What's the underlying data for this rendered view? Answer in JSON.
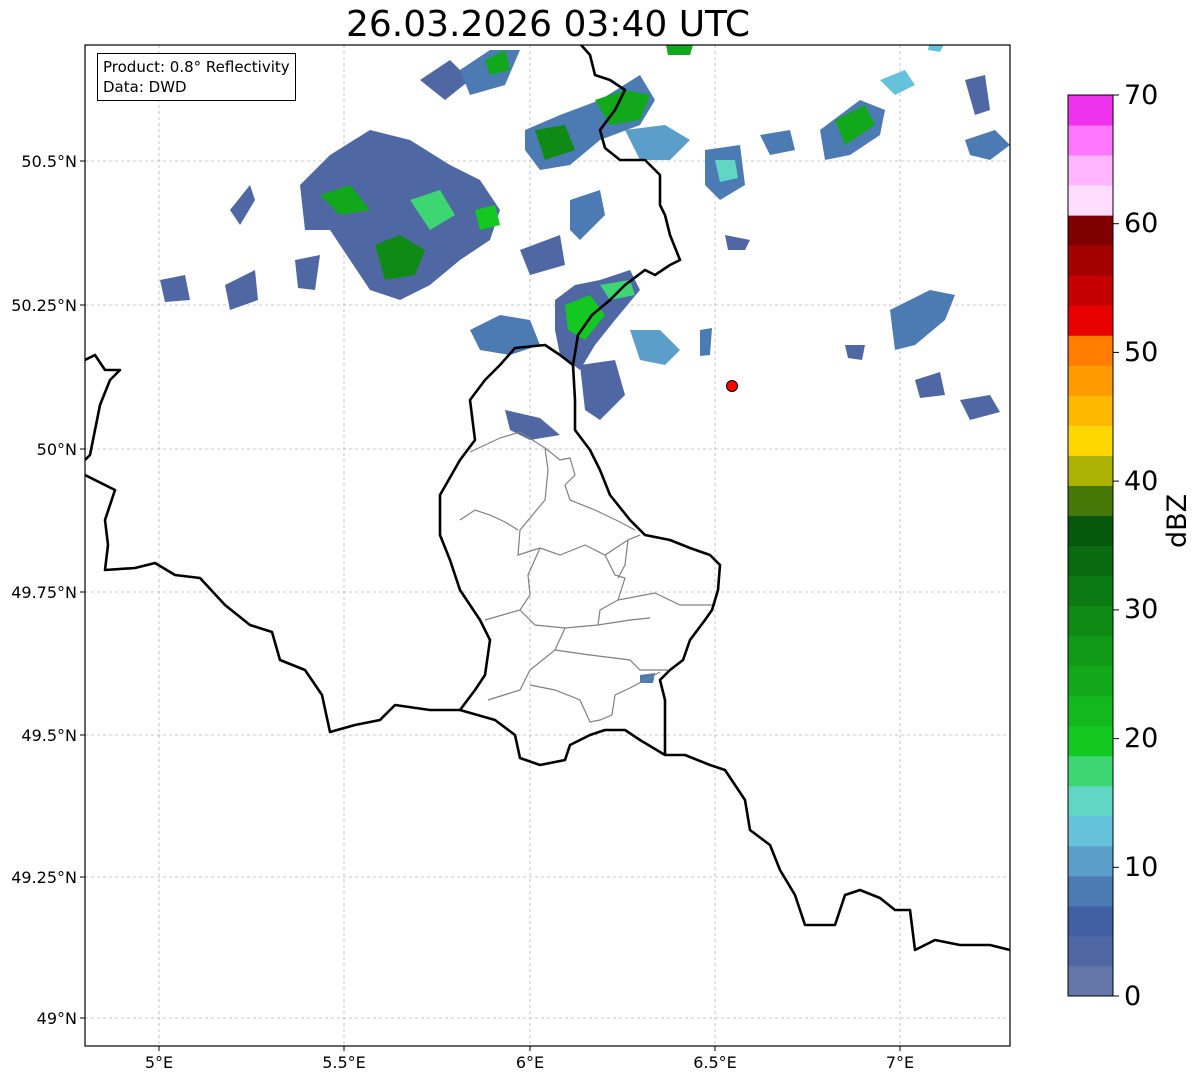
{
  "title": "26.03.2026 03:40 UTC",
  "info_box": {
    "product": "Product: 0.8° Reflectivity",
    "data": "Data: DWD"
  },
  "map": {
    "x_ticks": [
      "5°E",
      "5.5°E",
      "6°E",
      "6.5°E",
      "7°E"
    ],
    "y_ticks": [
      "50.5°N",
      "50.25°N",
      "50°N",
      "49.75°N",
      "49.5°N",
      "49.25°N",
      "49°N"
    ],
    "marker_color": "#ff0000"
  },
  "colorbar": {
    "unit": "dBZ",
    "tick_labels": [
      "0",
      "10",
      "20",
      "30",
      "40",
      "50",
      "60",
      "70"
    ],
    "colors": [
      "#6577a8",
      "#4f67a3",
      "#4060a3",
      "#4b7bb2",
      "#5a9ec9",
      "#66c2db",
      "#62d6c4",
      "#3ed672",
      "#13c821",
      "#12b81e",
      "#12a81b",
      "#109a18",
      "#0e8a15",
      "#0b7a12",
      "#096a10",
      "#05580c",
      "#457806",
      "#aeb204",
      "#ffd700",
      "#ffb800",
      "#ff9a00",
      "#ff7d00",
      "#e80000",
      "#c40000",
      "#a40000",
      "#800000",
      "#ffddff",
      "#ffb5ff",
      "#ff77ff",
      "#ee33ee"
    ]
  }
}
